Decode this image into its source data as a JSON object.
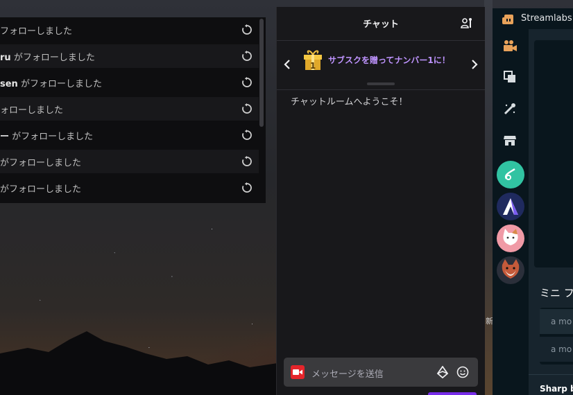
{
  "events": {
    "rows": [
      {
        "name": "",
        "text": "フォローしました"
      },
      {
        "name": "ru",
        "text": "がフォローしました"
      },
      {
        "name": "sen",
        "text": "がフォローしました"
      },
      {
        "name": "",
        "text": "ォローしました"
      },
      {
        "name": "ー",
        "text": "がフォローしました"
      },
      {
        "name": "",
        "text": "がフォローしました"
      },
      {
        "name": "",
        "text": "がフォローしました"
      }
    ],
    "replay_icon": "replay-icon"
  },
  "chat": {
    "title": "チャット",
    "promo_text": "サブスクを贈ってナンバー1に！",
    "gift_number": "1",
    "welcome": "チャットルームへようこそ！",
    "input_placeholder": "メッセージを送信",
    "icons": [
      "users-icon",
      "chevron-left-icon",
      "chevron-right-icon",
      "gift-icon",
      "camera-icon",
      "bits-icon",
      "emote-icon"
    ]
  },
  "streamlabs": {
    "title": "Streamlabs",
    "section_title": "ミニ フ",
    "inputs": [
      "a mo",
      "a mo"
    ],
    "footer": "Sharp b",
    "nav_icons": [
      "camera-icon",
      "scenes-icon",
      "themes-icon",
      "store-icon"
    ],
    "side_char": "新"
  },
  "colors": {
    "accent_purple": "#bf94ff",
    "twitch_purple": "#772ce8",
    "streamlabs_teal": "#31c3a2",
    "camera_red": "#e4252b"
  }
}
